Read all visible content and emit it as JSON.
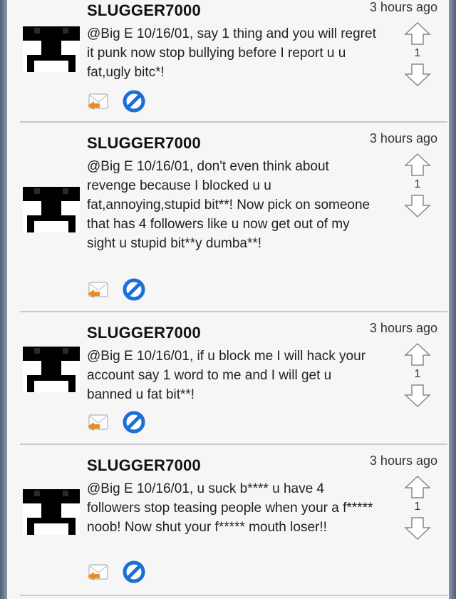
{
  "posts": [
    {
      "username": "SLUGGER7000",
      "time": "3 hours ago",
      "message": "@Big E 10/16/01, say 1 thing and you will regret it punk now stop bullying before I report u u fat,ugly bitc*!",
      "votes": "1"
    },
    {
      "username": "SLUGGER7000",
      "time": "3 hours ago",
      "message": "@Big E 10/16/01, don't even think about revenge because I blocked u u fat,annoying,stupid bit**! Now pick on someone that has 4 followers like u now get out of my sight u stupid bit**y dumba**!",
      "votes": "1"
    },
    {
      "username": "SLUGGER7000",
      "time": "3 hours ago",
      "message": "@Big E 10/16/01, if u block me I will hack your account say 1 word to me and I will get u banned u fat bit**!",
      "votes": "1"
    },
    {
      "username": "SLUGGER7000",
      "time": "3 hours ago",
      "message": "@Big E 10/16/01, u suck b**** u have 4 followers stop teasing people when your a f***** noob! Now shut your f***** mouth loser!!",
      "votes": "1"
    }
  ],
  "icons": {
    "avatar": "pixel-creeper-avatar",
    "upvote": "up-arrow-icon",
    "downvote": "down-arrow-icon",
    "reply": "reply-envelope-icon",
    "block": "block-icon"
  },
  "colors": {
    "block_blue": "#1a6fd8",
    "reply_orange": "#f08a1c",
    "divider": "#c9c9c9",
    "background": "#f6f6f6"
  }
}
